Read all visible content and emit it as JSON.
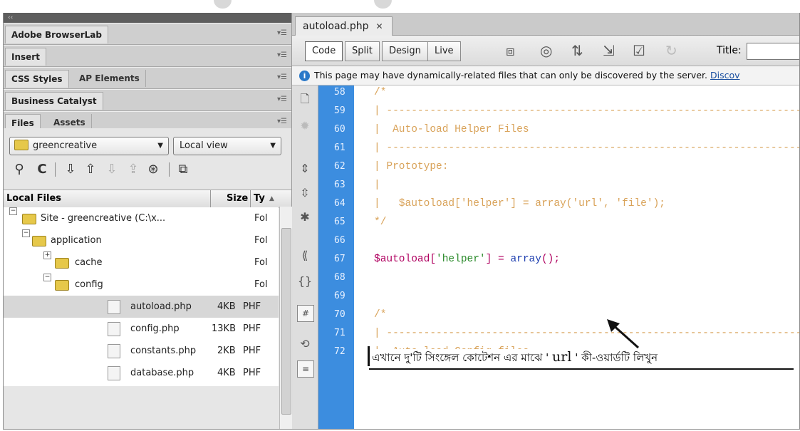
{
  "left_panel": {
    "collapse_glyph": "‹‹",
    "panels": [
      {
        "tabs": [
          "Adobe BrowserLab"
        ]
      },
      {
        "tabs": [
          "Insert"
        ]
      },
      {
        "tabs": [
          "CSS Styles",
          "AP Elements"
        ]
      },
      {
        "tabs": [
          "Business Catalyst"
        ]
      },
      {
        "tabs": [
          "Files",
          "Assets"
        ]
      }
    ],
    "site_select": "greencreative",
    "view_select": "Local view",
    "table_headers": {
      "name": "Local Files",
      "size": "Size",
      "type": "Ty"
    },
    "tree": [
      {
        "label": "Site - greencreative (C:\\x...",
        "size": "",
        "type": "Fol"
      },
      {
        "label": "application",
        "size": "",
        "type": "Fol"
      },
      {
        "label": "cache",
        "size": "",
        "type": "Fol"
      },
      {
        "label": "config",
        "size": "",
        "type": "Fol"
      },
      {
        "label": "autoload.php",
        "size": "4KB",
        "type": "PHF"
      },
      {
        "label": "config.php",
        "size": "13KB",
        "type": "PHF"
      },
      {
        "label": "constants.php",
        "size": "2KB",
        "type": "PHF"
      },
      {
        "label": "database.php",
        "size": "4KB",
        "type": "PHF"
      }
    ]
  },
  "editor": {
    "doc_tab": "autoload.php",
    "view_buttons": [
      "Code",
      "Split",
      "Design",
      "Live"
    ],
    "title_label": "Title:",
    "info_message": "This page may have dynamically-related files that can only be discovered by the server.",
    "info_link": "Discov",
    "line_numbers": [
      "58",
      "59",
      "60",
      "61",
      "62",
      "63",
      "64",
      "65",
      "66",
      "67",
      "68",
      "69",
      "70",
      "71",
      "72"
    ],
    "code_lines": [
      "/*",
      "| -------------------------------------------------------------------",
      "|  Auto-load Helper Files",
      "| -------------------------------------------------------------------",
      "| Prototype:",
      "|",
      "|   $autoload['helper'] = array('url', 'file');",
      "*/",
      "",
      "",
      "",
      "",
      "/*",
      "| -------------------------------------------------------------------",
      "|  Auto-load Config files"
    ],
    "php_line": {
      "var": "$autoload[",
      "key": "'helper'",
      "mid": "] = ",
      "fn": "array",
      "end": "();"
    }
  },
  "annotation": {
    "before": "এখানে দু'টি সিংঙ্গেল কোটেশন এর মাঝে ' ",
    "url": "url",
    "after": " ' কী-ওয়ার্ডটি লিখুন"
  }
}
